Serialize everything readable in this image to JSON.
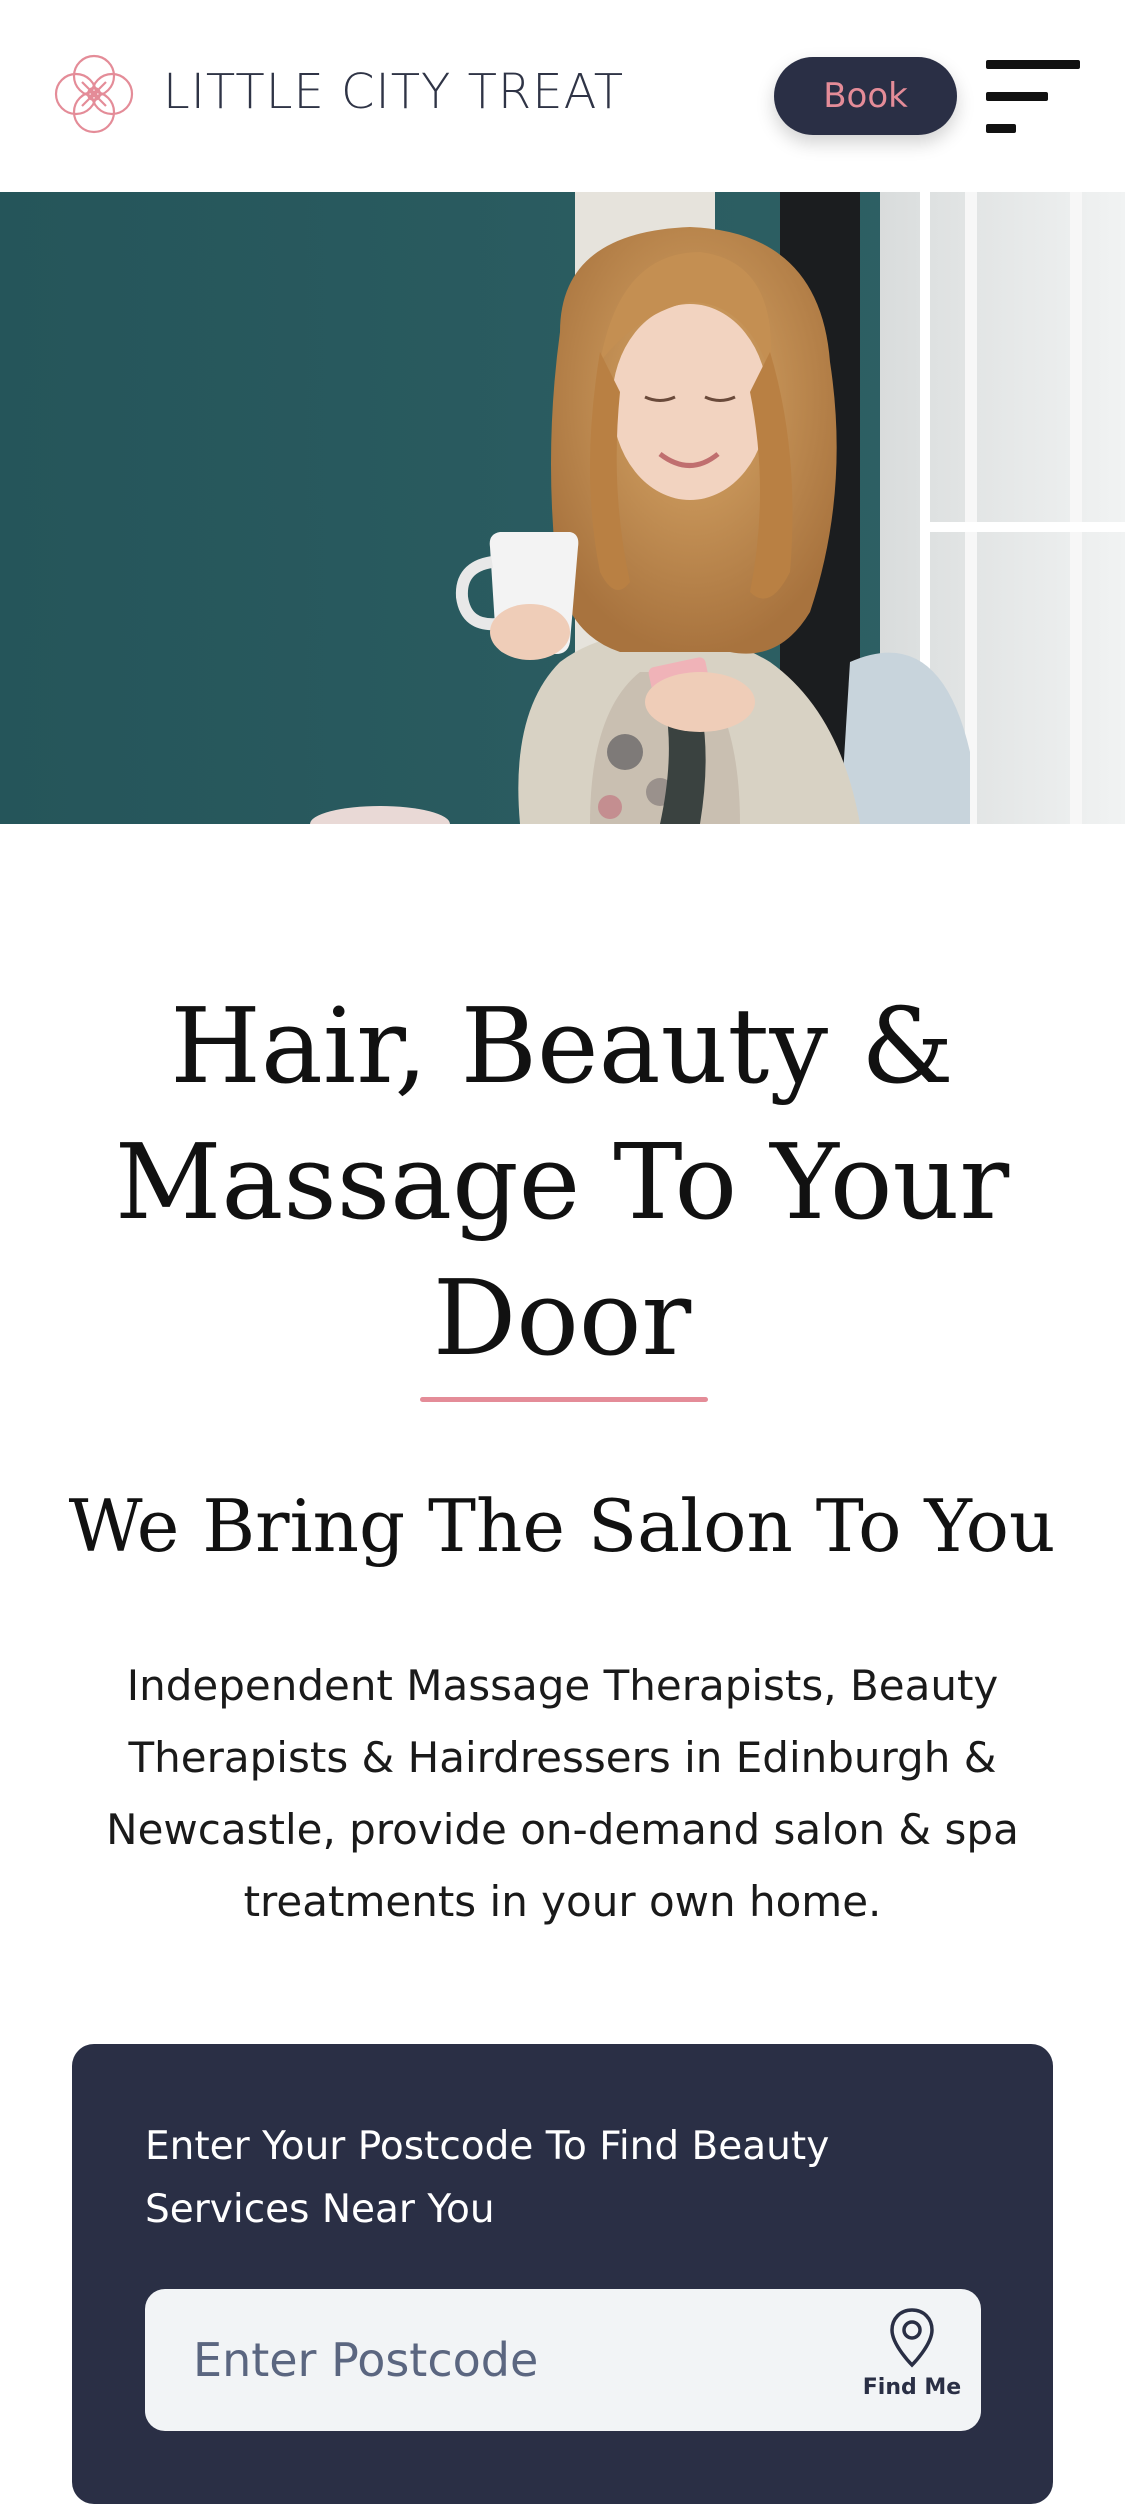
{
  "header": {
    "brand_name": "LITTLE CITY TREAT",
    "logo_icon": "floral-knot-icon",
    "book_label": "Book",
    "menu_icon": "hamburger-menu-icon"
  },
  "hero": {
    "image_subject": "photo"
  },
  "main": {
    "headline": "Hair, Beauty & Massage To Your Door",
    "subheading": "We Bring The Salon To You",
    "intro": "Independent Massage Therapists, Beauty Therapists & Hairdressers in Edinburgh & Newcastle, provide on-demand salon & spa treatments in your own home."
  },
  "postcode_search": {
    "title": "Enter Your Postcode To Find Beauty Services Near You",
    "value": "",
    "placeholder": "Enter Postcode",
    "find_me_label": "Find Me",
    "find_me_icon": "location-pin-icon"
  },
  "colors": {
    "navy": "#2a2f45",
    "accent_pink": "#e48c98",
    "teal_wall": "#2c5a5e",
    "field_bg": "#f2f4f6"
  }
}
